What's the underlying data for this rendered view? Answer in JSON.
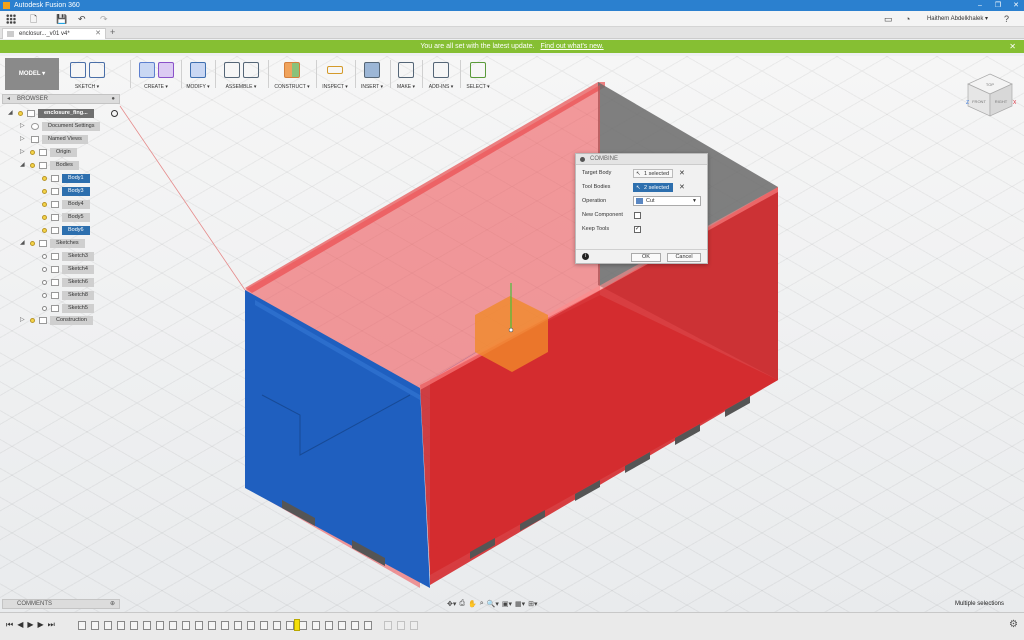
{
  "app": {
    "title": "Autodesk Fusion 360",
    "window_controls": [
      "–",
      "❐",
      "✕"
    ]
  },
  "qab": {
    "user": "Haithem Abdelkhalek ▾",
    "help": "?"
  },
  "tabs": [
    {
      "label": "enclosur..._v01 v4*"
    }
  ],
  "banner": {
    "message": "You are all set with the latest update.",
    "link": "Find out what's new."
  },
  "toolbar": {
    "workspace": "MODEL ▾",
    "groups": [
      {
        "label": "SKETCH ▾"
      },
      {
        "label": "CREATE ▾"
      },
      {
        "label": "MODIFY ▾"
      },
      {
        "label": "ASSEMBLE ▾"
      },
      {
        "label": "CONSTRUCT ▾"
      },
      {
        "label": "INSPECT ▾"
      },
      {
        "label": "INSERT ▾"
      },
      {
        "label": "MAKE ▾"
      },
      {
        "label": "ADD-INS ▾"
      },
      {
        "label": "SELECT ▾"
      }
    ]
  },
  "browser": {
    "title": "BROWSER",
    "root": "enclosure_fing...",
    "items": [
      {
        "label": "Document Settings"
      },
      {
        "label": "Named Views"
      },
      {
        "label": "Origin"
      },
      {
        "label": "Bodies"
      },
      {
        "label": "Body1"
      },
      {
        "label": "Body3"
      },
      {
        "label": "Body4"
      },
      {
        "label": "Body5"
      },
      {
        "label": "Body6"
      },
      {
        "label": "Sketches"
      },
      {
        "label": "Sketch3"
      },
      {
        "label": "Sketch4"
      },
      {
        "label": "Sketch6"
      },
      {
        "label": "Sketch8"
      },
      {
        "label": "Sketch5"
      },
      {
        "label": "Construction"
      }
    ]
  },
  "comments": {
    "title": "COMMENTS"
  },
  "dialog": {
    "title": "COMBINE",
    "target_label": "Target Body",
    "target_value": "1 selected",
    "tool_label": "Tool Bodies",
    "tool_value": "2 selected",
    "operation_label": "Operation",
    "operation_value": "Cut",
    "new_component_label": "New Component",
    "new_component_checked": false,
    "keep_tools_label": "Keep Tools",
    "keep_tools_checked": true,
    "ok": "OK",
    "cancel": "Cancel"
  },
  "viewcube": {
    "top": "TOP",
    "front": "FRONT",
    "right": "RIGHT"
  },
  "status": "Multiple selections",
  "colors": {
    "title_bar": "#2b80cf",
    "banner": "#86bf33",
    "selection_blue": "#2d6fae",
    "target_body": "#1f5fbf",
    "tool_bodies": "#e8383d"
  }
}
